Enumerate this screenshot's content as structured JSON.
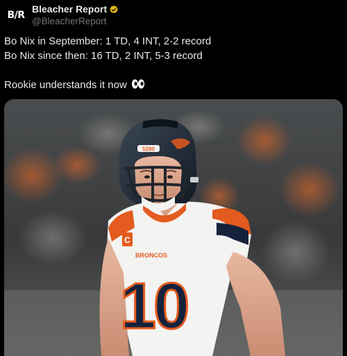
{
  "tweet": {
    "avatar_text": "B/R",
    "display_name": "Bleacher Report",
    "handle": "@BleacherReport",
    "verified": true,
    "verified_color": "#e2b719",
    "lines": [
      "Bo Nix in September: 1 TD, 4 INT, 2-2 record",
      "Bo Nix since then: 16 TD, 2 INT, 5-3 record",
      "",
      "Rookie understands it now"
    ],
    "emoji": "eyes-emoji"
  },
  "media": {
    "subject": "football-player-photo",
    "helmet_text": "5280",
    "jersey_text": "BRONCOS",
    "jersey_number": "10",
    "captain_patch": "C",
    "colors": {
      "helmet": "#1b2635",
      "jersey": "#f3f3f1",
      "orange": "#e35b1e",
      "navy": "#14223c"
    }
  }
}
